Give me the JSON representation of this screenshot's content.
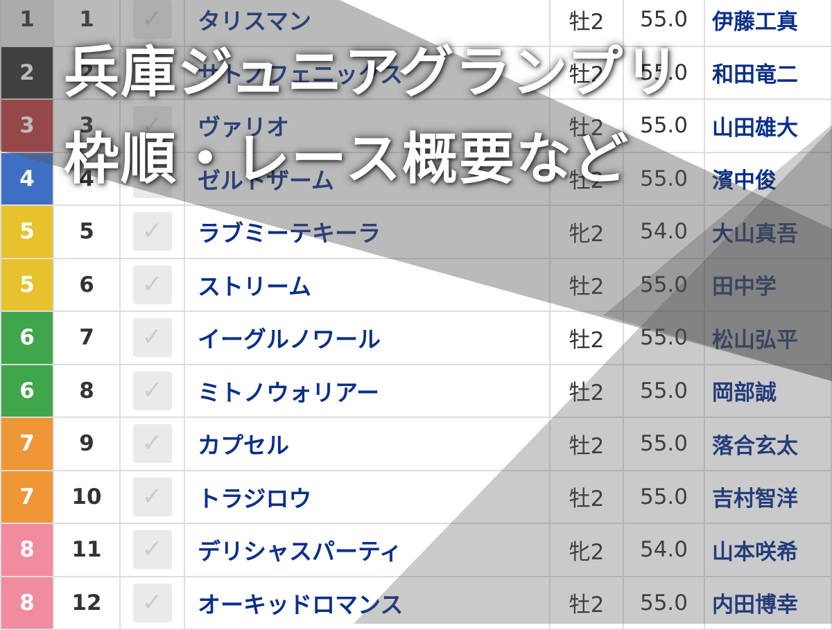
{
  "title": {
    "line1": "兵庫ジュニアグランプリ",
    "line2": "枠順・レース概要など"
  },
  "waku_colors": {
    "1": "#e6e6e6",
    "2": "#2e2e2e",
    "3": "#c23a3e",
    "4": "#3f6fc4",
    "5": "#e8c22c",
    "6": "#3fa64c",
    "7": "#ef9636",
    "8": "#f08ba0"
  },
  "check_icon": "checkmark-icon",
  "rows": [
    {
      "waku": "1",
      "num": "1",
      "name": "タリスマン",
      "sex": "牡2",
      "weight": "55.0",
      "jockey": "伊藤工真"
    },
    {
      "waku": "2",
      "num": "2",
      "name": "サトノフェニックス",
      "sex": "牡2",
      "weight": "55.0",
      "jockey": "和田竜二"
    },
    {
      "waku": "3",
      "num": "3",
      "name": "ヴァリオ",
      "sex": "牡2",
      "weight": "55.0",
      "jockey": "山田雄大"
    },
    {
      "waku": "4",
      "num": "4",
      "name": "ゼルトザーム",
      "sex": "牡2",
      "weight": "55.0",
      "jockey": "濱中俊"
    },
    {
      "waku": "5",
      "num": "5",
      "name": "ラブミーテキーラ",
      "sex": "牝2",
      "weight": "54.0",
      "jockey": "大山真吾"
    },
    {
      "waku": "5",
      "num": "6",
      "name": "ストリーム",
      "sex": "牡2",
      "weight": "55.0",
      "jockey": "田中学"
    },
    {
      "waku": "6",
      "num": "7",
      "name": "イーグルノワール",
      "sex": "牡2",
      "weight": "55.0",
      "jockey": "松山弘平"
    },
    {
      "waku": "6",
      "num": "8",
      "name": "ミトノウォリアー",
      "sex": "牡2",
      "weight": "55.0",
      "jockey": "岡部誠"
    },
    {
      "waku": "7",
      "num": "9",
      "name": "カプセル",
      "sex": "牡2",
      "weight": "55.0",
      "jockey": "落合玄太"
    },
    {
      "waku": "7",
      "num": "10",
      "name": "トラジロウ",
      "sex": "牡2",
      "weight": "55.0",
      "jockey": "吉村智洋"
    },
    {
      "waku": "8",
      "num": "11",
      "name": "デリシャスパーティ",
      "sex": "牝2",
      "weight": "54.0",
      "jockey": "山本咲希"
    },
    {
      "waku": "8",
      "num": "12",
      "name": "オーキッドロマンス",
      "sex": "牡2",
      "weight": "55.0",
      "jockey": "内田博幸"
    }
  ]
}
